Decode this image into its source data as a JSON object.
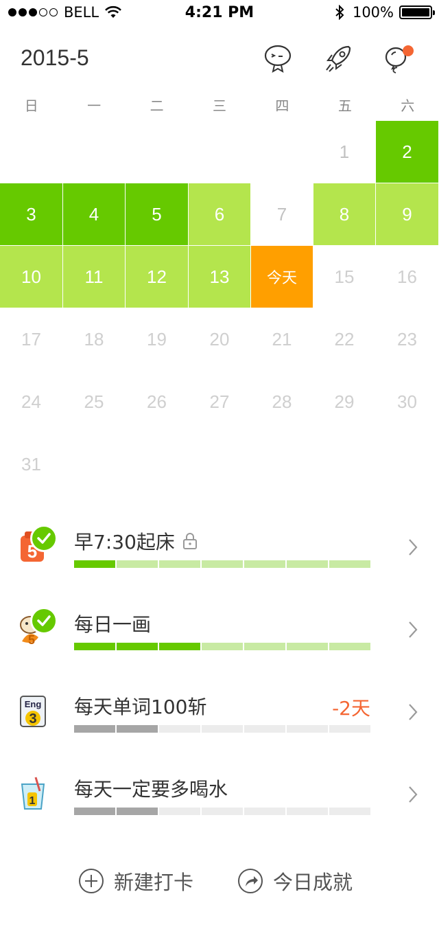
{
  "statusbar": {
    "carrier": "BELL",
    "time": "4:21 PM",
    "battery": "100%"
  },
  "header": {
    "month": "2015-5"
  },
  "weekdays": [
    "日",
    "一",
    "二",
    "三",
    "四",
    "五",
    "六"
  ],
  "calendar": [
    {
      "label": "",
      "state": "empty"
    },
    {
      "label": "",
      "state": "empty"
    },
    {
      "label": "",
      "state": "empty"
    },
    {
      "label": "",
      "state": "empty"
    },
    {
      "label": "",
      "state": "empty"
    },
    {
      "label": "1",
      "state": "past"
    },
    {
      "label": "2",
      "state": "green"
    },
    {
      "label": "3",
      "state": "green"
    },
    {
      "label": "4",
      "state": "green"
    },
    {
      "label": "5",
      "state": "green"
    },
    {
      "label": "6",
      "state": "lightgreen"
    },
    {
      "label": "7",
      "state": "past"
    },
    {
      "label": "8",
      "state": "lightgreen"
    },
    {
      "label": "9",
      "state": "lightgreen"
    },
    {
      "label": "10",
      "state": "lightgreen"
    },
    {
      "label": "11",
      "state": "lightgreen"
    },
    {
      "label": "12",
      "state": "lightgreen"
    },
    {
      "label": "13",
      "state": "lightgreen"
    },
    {
      "label": "今天",
      "state": "today"
    },
    {
      "label": "15",
      "state": "future"
    },
    {
      "label": "16",
      "state": "future"
    },
    {
      "label": "17",
      "state": "future"
    },
    {
      "label": "18",
      "state": "future"
    },
    {
      "label": "19",
      "state": "future"
    },
    {
      "label": "20",
      "state": "future"
    },
    {
      "label": "21",
      "state": "future"
    },
    {
      "label": "22",
      "state": "future"
    },
    {
      "label": "23",
      "state": "future"
    },
    {
      "label": "24",
      "state": "future"
    },
    {
      "label": "25",
      "state": "future"
    },
    {
      "label": "26",
      "state": "future"
    },
    {
      "label": "27",
      "state": "future"
    },
    {
      "label": "28",
      "state": "future"
    },
    {
      "label": "29",
      "state": "future"
    },
    {
      "label": "30",
      "state": "future"
    },
    {
      "label": "31",
      "state": "future"
    }
  ],
  "colors": {
    "green": "#66c900",
    "lightgreen": "#b4e54d",
    "today": "#ff9f00",
    "accent": "#f46633"
  },
  "tasks": [
    {
      "name": "早7:30起床",
      "locked": true,
      "checked": true,
      "overdue": "",
      "icon": "badge-5-icon",
      "progress": 1,
      "total": 7,
      "bar": "green"
    },
    {
      "name": "每日一画",
      "locked": false,
      "checked": true,
      "overdue": "",
      "icon": "painter-icon",
      "progress": 3,
      "total": 7,
      "bar": "green"
    },
    {
      "name": "每天单词100斩",
      "locked": false,
      "checked": false,
      "overdue": "-2天",
      "icon": "eng-3-icon",
      "progress": 2,
      "total": 7,
      "bar": "gray"
    },
    {
      "name": "每天一定要多喝水",
      "locked": false,
      "checked": false,
      "overdue": "",
      "icon": "water-cup-icon",
      "progress": 2,
      "total": 7,
      "bar": "gray"
    }
  ],
  "footer": {
    "new_label": "新建打卡",
    "achieve_label": "今日成就"
  }
}
